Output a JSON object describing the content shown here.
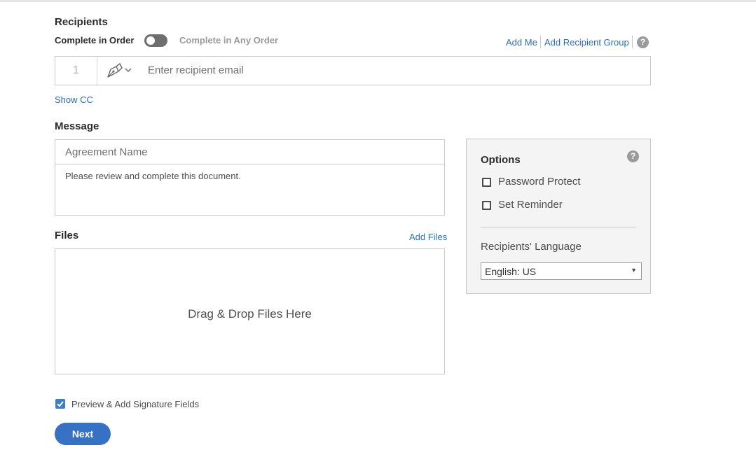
{
  "recipients": {
    "heading": "Recipients",
    "order_on_label": "Complete in Order",
    "order_off_label": "Complete in Any Order",
    "add_me": "Add Me",
    "add_group": "Add Recipient Group",
    "help": "?",
    "row": {
      "number": "1",
      "role_icon": "pen-signer-icon",
      "email_placeholder": "Enter recipient email"
    },
    "show_cc": "Show CC"
  },
  "message": {
    "heading": "Message",
    "name_placeholder": "Agreement Name",
    "body": "Please review and complete this document."
  },
  "files": {
    "heading": "Files",
    "add_files": "Add Files",
    "drop_text": "Drag & Drop Files Here"
  },
  "options": {
    "title": "Options",
    "help": "?",
    "password_protect": "Password Protect",
    "set_reminder": "Set Reminder",
    "language_label": "Recipients' Language",
    "language_value": "English: US"
  },
  "footer": {
    "preview_label": "Preview & Add Signature Fields",
    "preview_checked": true,
    "next": "Next"
  },
  "colors": {
    "link": "#2d6db5",
    "primary_button": "#3671c4",
    "checkbox_checked": "#3d7fc7",
    "panel_bg": "#f4f4f4"
  }
}
